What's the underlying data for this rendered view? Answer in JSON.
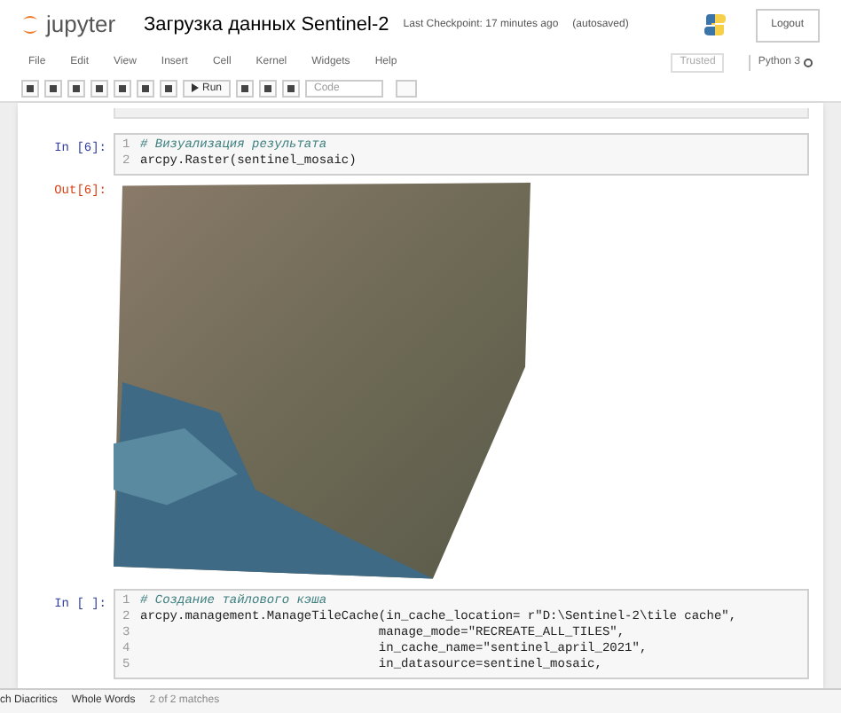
{
  "header": {
    "logo": "jupyter",
    "title": "Загрузка данных Sentinel-2",
    "checkpoint": "Last Checkpoint: 17 minutes ago",
    "autosave": "(autosaved)",
    "logout": "Logout"
  },
  "menu": [
    "File",
    "Edit",
    "View",
    "Insert",
    "Cell",
    "Kernel",
    "Widgets",
    "Help"
  ],
  "kernel": {
    "trusted": "Trusted",
    "name": "Python 3"
  },
  "toolbar": {
    "run": "Run",
    "cell_type": "Code"
  },
  "cells": [
    {
      "kind": "code",
      "prompt": "In [6]:",
      "lines": [
        {
          "no": "1",
          "text": "# Визуализация результата",
          "comment": true
        },
        {
          "no": "2",
          "text": "arcpy.Raster(sentinel_mosaic)",
          "comment": false
        }
      ]
    },
    {
      "kind": "output",
      "prompt": "Out[6]:"
    },
    {
      "kind": "code",
      "prompt": "In [ ]:",
      "lines": [
        {
          "no": "1",
          "text": "# Создание тайлового кэша",
          "comment": true
        },
        {
          "no": "2",
          "text": "arcpy.management.ManageTileCache(in_cache_location= r\"D:\\Sentinel-2\\tile cache\",",
          "comment": false
        },
        {
          "no": "3",
          "text": "                                manage_mode=\"RECREATE_ALL_TILES\",",
          "comment": false
        },
        {
          "no": "4",
          "text": "                                in_cache_name=\"sentinel_april_2021\",",
          "comment": false
        },
        {
          "no": "5",
          "text": "                                in_datasource=sentinel_mosaic,",
          "comment": false
        }
      ]
    }
  ],
  "find_bar": {
    "options": [
      "ch Diacritics",
      "Whole Words"
    ],
    "matches": "2 of 2 matches"
  }
}
